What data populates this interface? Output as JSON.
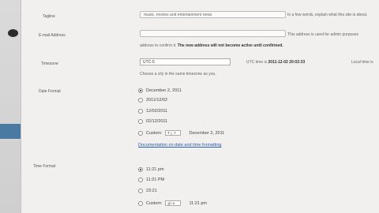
{
  "sidebar": {
    "toggle_icon": "toggle-dot-icon"
  },
  "form": {
    "tagline": {
      "label": "Tagline",
      "value": "music, movies and entertainment news",
      "note": "In a few words, explain what this site is about."
    },
    "email": {
      "label": "E-mail Address",
      "value": "",
      "note_prefix": "This address is used for admin purposes",
      "note_line2_a": "address to confirm it.",
      "note_line2_b": "The new address will not become active until confirmed."
    },
    "timezone": {
      "label": "Timezone",
      "value": "UTC-5",
      "utc_prefix": "UTC time is",
      "utc_value": "2011-12-02 20:02:33",
      "local_label": "Local time is",
      "hint": "Choose a city in the same timezone as you."
    },
    "date_format": {
      "label": "Date Format",
      "options": [
        "December 2, 2011",
        "2011/12/02",
        "12/02/2011",
        "02/12/2011"
      ],
      "selected": 0,
      "custom_label": "Custom:",
      "custom_value": "F j, Y",
      "custom_preview": "December 2, 2011",
      "doc_link": "Documentation on date and time formatting"
    },
    "time_format": {
      "label": "Time Format",
      "options": [
        "11:21 pm",
        "11:21 PM",
        "23:21"
      ],
      "selected": 0,
      "custom_label": "Custom:",
      "custom_value": "g:i a",
      "custom_preview": "11:21 pm"
    }
  }
}
